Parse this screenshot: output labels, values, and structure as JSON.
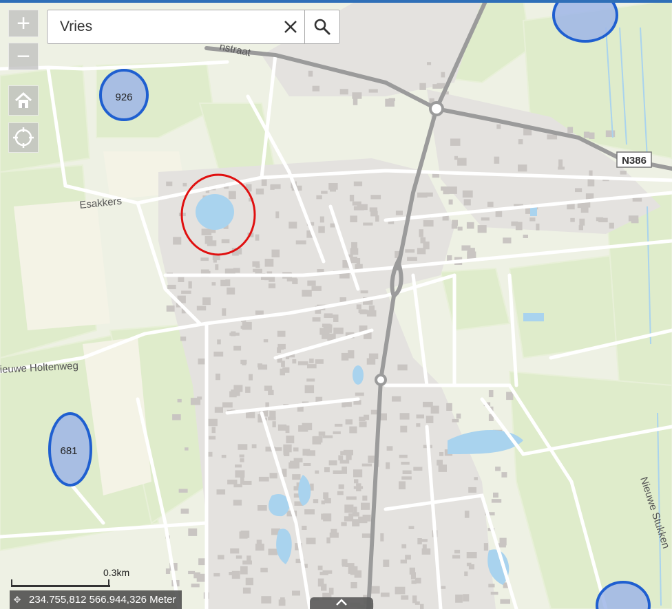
{
  "search": {
    "value": "Vries"
  },
  "zoom": {
    "in_label": "+",
    "out_label": "−"
  },
  "scalebar": {
    "label": "0.3km"
  },
  "coordinates": {
    "text": "234.755,812 566.944,326 Meter"
  },
  "map_labels": {
    "street_top": "nstraat",
    "esakkers": "Esakkers",
    "holtenweg": "ieuwe Holtenweg",
    "stukken": "Nieuwe Stukken",
    "road_shield": "N386"
  },
  "markers": [
    {
      "label": "926"
    },
    {
      "label": "681"
    }
  ],
  "colors": {
    "accent": "#2f6fb8",
    "marker_stroke": "#1f5fd0",
    "marker_fill": "#9fb6e8",
    "highlight_ring": "#e01010",
    "water": "#a9d3ee"
  }
}
